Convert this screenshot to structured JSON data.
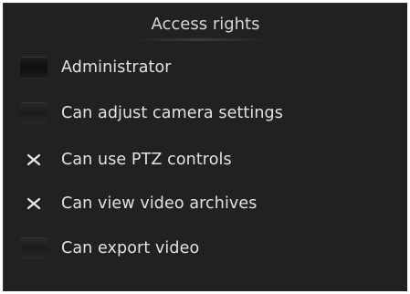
{
  "panel": {
    "title": "Access rights"
  },
  "rights": [
    {
      "label": "Administrator",
      "checked": false,
      "checkbox_icon": "unchecked-box-icon"
    },
    {
      "label": "Can adjust camera settings",
      "checked": false,
      "checkbox_icon": "unchecked-box-icon"
    },
    {
      "label": "Can use PTZ controls",
      "checked": true,
      "checkbox_icon": "check-x-icon"
    },
    {
      "label": "Can view video archives",
      "checked": true,
      "checkbox_icon": "check-x-icon"
    },
    {
      "label": "Can export video",
      "checked": false,
      "checkbox_icon": "unchecked-box-icon"
    }
  ],
  "colors": {
    "panel_background": "#212121",
    "text": "#e2e2e2",
    "title_text": "#d6d6d6",
    "check_mark": "#e8e8e8"
  }
}
